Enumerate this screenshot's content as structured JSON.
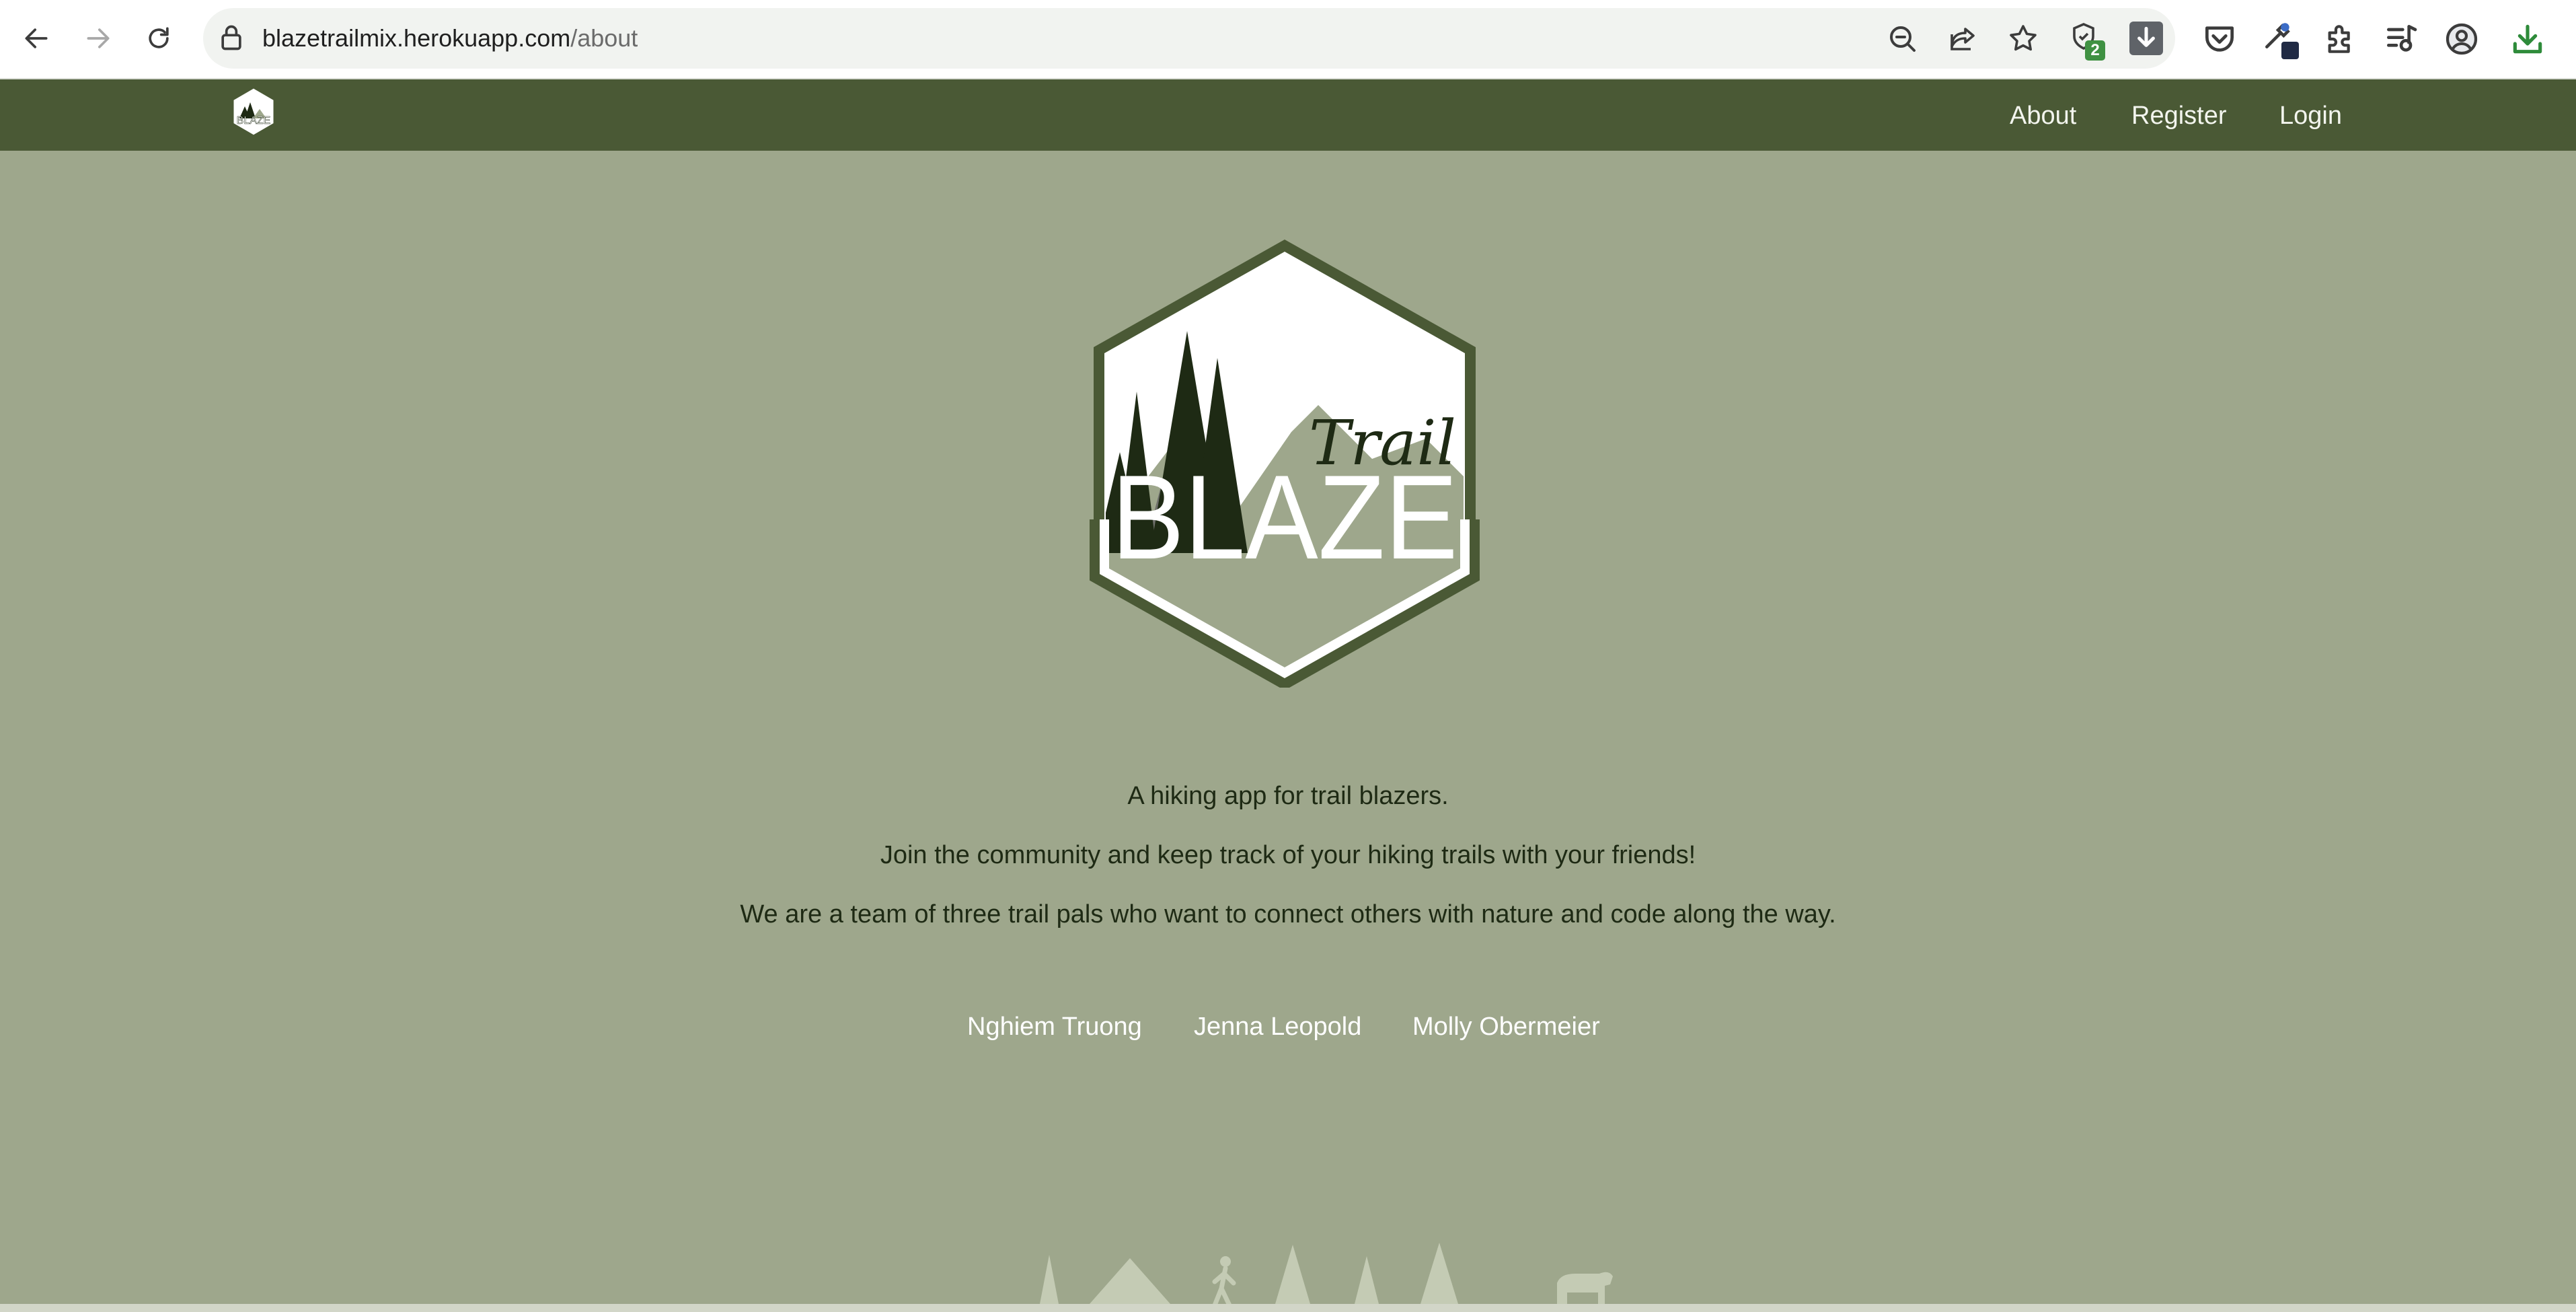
{
  "browser": {
    "url_host": "blazetrailmix.herokuapp.com",
    "url_path": "/about",
    "shield_badge": "2",
    "icons": [
      "back-arrow-icon",
      "forward-arrow-icon",
      "reload-icon",
      "lock-icon",
      "zoom-out-icon",
      "share-icon",
      "star-icon",
      "shield-icon",
      "download-arrow-icon",
      "pocket-icon",
      "eyedropper-icon",
      "puzzle-icon",
      "media-queue-icon",
      "profile-icon",
      "download-icon"
    ]
  },
  "navbar": {
    "brand_alt": "BLAZE",
    "links": [
      "About",
      "Register",
      "Login"
    ]
  },
  "hero": {
    "logo_script": "Trail",
    "logo_word": "BLAZE"
  },
  "about": {
    "line1": "A hiking app for trail blazers.",
    "line2": "Join the community and keep track of your hiking trails with your friends!",
    "line3": "We are a team of three trail pals who want to connect others with nature and code along the way."
  },
  "team": [
    "Nghiem Truong",
    "Jenna Leopold",
    "Molly Obermeier"
  ],
  "colors": {
    "page_bg": "#9ea78c",
    "navbar_bg": "#4a5935",
    "logo_border": "#4a5935",
    "tree_dark": "#1e2a14",
    "footer_silhouette": "#c4cbb4"
  }
}
